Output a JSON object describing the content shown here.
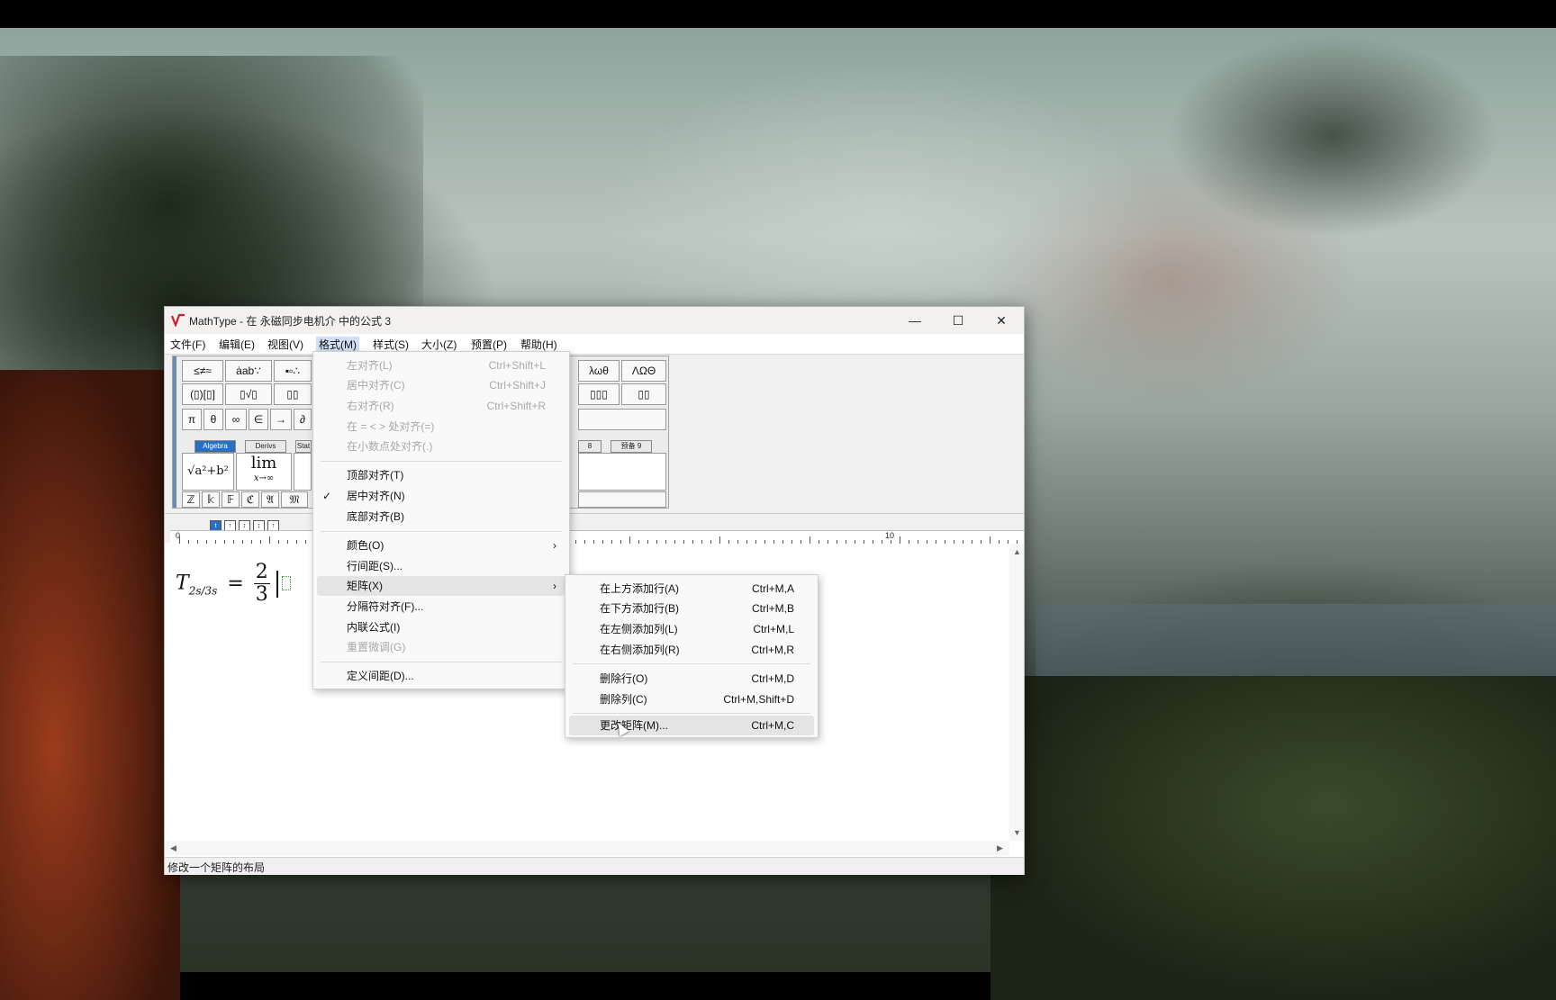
{
  "window": {
    "title": "MathType - 在 永磁同步电机介 中的公式 3",
    "minimize_glyph": "—",
    "maximize_glyph": "☐",
    "close_glyph": "✕"
  },
  "menubar": [
    {
      "label": "文件(F)"
    },
    {
      "label": "编辑(E)"
    },
    {
      "label": "视图(V)"
    },
    {
      "label": "格式(M)"
    },
    {
      "label": "样式(S)"
    },
    {
      "label": "大小(Z)"
    },
    {
      "label": "预置(P)"
    },
    {
      "label": "帮助(H)"
    }
  ],
  "palette": {
    "row1": [
      "≤≠≈",
      "ȧab∵",
      "▪▫∴",
      "λωθ",
      "ΛΩΘ"
    ],
    "row2": [
      "(▯)[▯]",
      "▯√▯",
      "▯▯",
      "▯▯▯",
      "▯▯"
    ],
    "row3": [
      "π",
      "θ",
      "∞",
      "∈",
      "→",
      "∂"
    ],
    "tabs": [
      "Algebra",
      "Derivs",
      "Stat",
      "8",
      "预备 9"
    ],
    "big1": "√a²+b²",
    "big2_top": "lim",
    "big2_bottom": "x→∞",
    "row5": [
      "ℤ",
      "𝕜",
      "𝔽",
      "ℭ",
      "𝔄",
      "𝔐"
    ]
  },
  "tabstops": [
    "t",
    "↑",
    "↕",
    "↨",
    "↑"
  ],
  "ruler": {
    "start": "0",
    "mark": "10"
  },
  "equation": {
    "lhs": "T",
    "subscript": "2s/3s",
    "equals": "=",
    "num": "2",
    "den": "3"
  },
  "status": "修改一个矩阵的布局",
  "format_menu": {
    "items": [
      {
        "label": "左对齐(L)",
        "shortcut": "Ctrl+Shift+L",
        "disabled": true
      },
      {
        "label": "居中对齐(C)",
        "shortcut": "Ctrl+Shift+J",
        "disabled": true
      },
      {
        "label": "右对齐(R)",
        "shortcut": "Ctrl+Shift+R",
        "disabled": true
      },
      {
        "label": "在 = < > 处对齐(=)",
        "shortcut": "",
        "disabled": true
      },
      {
        "label": "在小数点处对齐(.)",
        "shortcut": "",
        "disabled": true
      },
      {
        "label": "顶部对齐(T)",
        "shortcut": ""
      },
      {
        "label": "居中对齐(N)",
        "shortcut": "",
        "checked": true
      },
      {
        "label": "底部对齐(B)",
        "shortcut": ""
      },
      {
        "label": "颜色(O)",
        "submenu": true
      },
      {
        "label": "行间距(S)..."
      },
      {
        "label": "矩阵(X)",
        "submenu": true,
        "highlighted": true
      },
      {
        "label": "分隔符对齐(F)..."
      },
      {
        "label": "内联公式(I)"
      },
      {
        "label": "重置微调(G)",
        "disabled": true
      },
      {
        "label": "定义间距(D)..."
      }
    ],
    "check_glyph": "✓",
    "submenu_glyph": "›"
  },
  "matrix_submenu": [
    {
      "label": "在上方添加行(A)",
      "shortcut": "Ctrl+M,A"
    },
    {
      "label": "在下方添加行(B)",
      "shortcut": "Ctrl+M,B"
    },
    {
      "label": "在左侧添加列(L)",
      "shortcut": "Ctrl+M,L"
    },
    {
      "label": "在右侧添加列(R)",
      "shortcut": "Ctrl+M,R"
    },
    {
      "label": "删除行(O)",
      "shortcut": "Ctrl+M,D"
    },
    {
      "label": "删除列(C)",
      "shortcut": "Ctrl+M,Shift+D"
    },
    {
      "label": "更改矩阵(M)...",
      "shortcut": "Ctrl+M,C",
      "highlighted": true
    }
  ]
}
